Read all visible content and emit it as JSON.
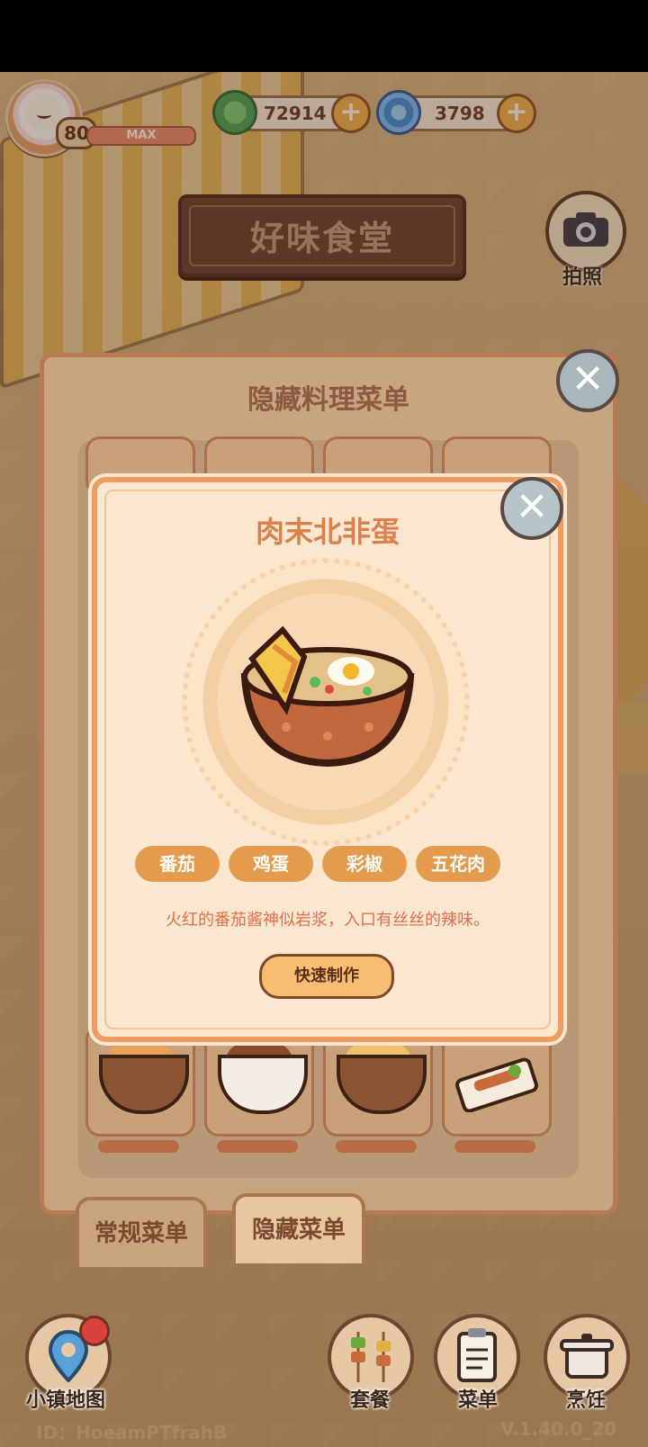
{
  "hud": {
    "level": "80",
    "xp_label": "MAX",
    "leaf_currency": "72914",
    "gem_currency": "3798",
    "plus": "+"
  },
  "restaurant": {
    "sign": "好味食堂"
  },
  "camera": {
    "label": "拍照",
    "icon": "camera-icon"
  },
  "outer_dialog": {
    "title": "隐藏料理菜单",
    "close": "✕",
    "tabs": [
      {
        "label": "常规菜单"
      },
      {
        "label": "隐藏菜单"
      }
    ]
  },
  "detail": {
    "title": "肉末北非蛋",
    "close": "✕",
    "ingredients": [
      "番茄",
      "鸡蛋",
      "彩椒",
      "五花肉"
    ],
    "description": "火红的番茄酱神似岩浆，入口有丝丝的辣味。",
    "make_button": "快速制作"
  },
  "bottom_nav": {
    "map": "小镇地图",
    "set_meal": "套餐",
    "menu": "菜单",
    "cook": "烹饪"
  },
  "footer": {
    "player_id": "ID：HoeamPTfrahB",
    "version": "V.1.40.0_20"
  },
  "colors": {
    "accent_orange": "#e39c4e",
    "panel_cream": "#fbe6d0",
    "title_orange": "#d9824e",
    "description_red": "#e0704a"
  }
}
